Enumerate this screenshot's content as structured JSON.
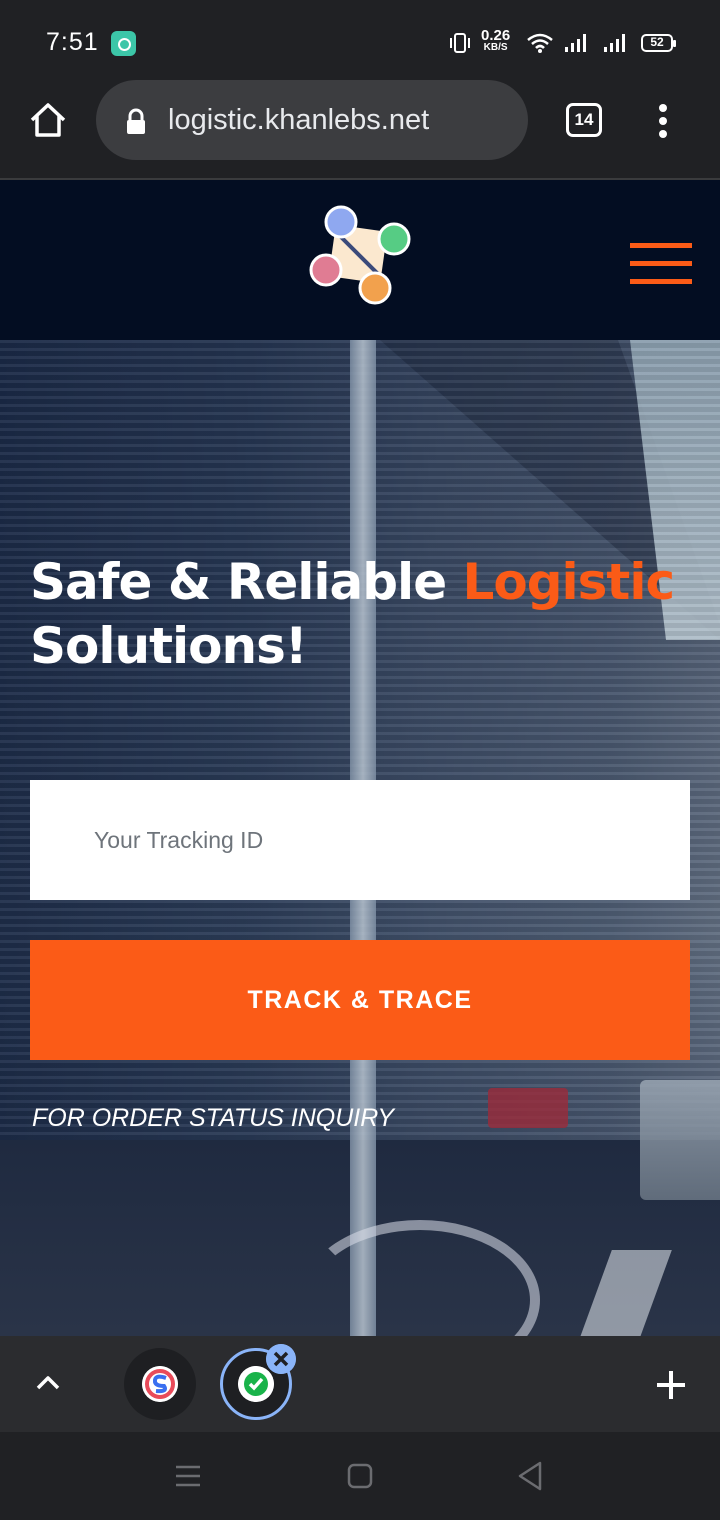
{
  "status_bar": {
    "time": "7:51",
    "net_speed_value": "0.26",
    "net_speed_unit": "KB/S",
    "battery": "52"
  },
  "browser": {
    "url": "logistic.khanlebs.net",
    "tab_count": "14"
  },
  "hero": {
    "title_part1": "Safe & Reliable ",
    "title_accent": "Logistic",
    "title_part2": "Solutions!",
    "tracking_placeholder": "Your Tracking ID",
    "track_button_label": "TRACK & TRACE",
    "inquiry_text": "FOR ORDER STATUS INQUIRY"
  },
  "colors": {
    "accent": "#fb5b17",
    "header_bg": "#030d22",
    "browser_bg": "#202124"
  },
  "icons": [
    "vibrate-icon",
    "wifi-icon",
    "signal-icon",
    "battery-icon",
    "home-icon",
    "lock-icon",
    "tabs-icon",
    "more-vert-icon",
    "hamburger-icon",
    "chevron-up-icon",
    "plus-icon",
    "close-icon",
    "recent-apps-icon",
    "home-nav-icon",
    "back-icon"
  ]
}
